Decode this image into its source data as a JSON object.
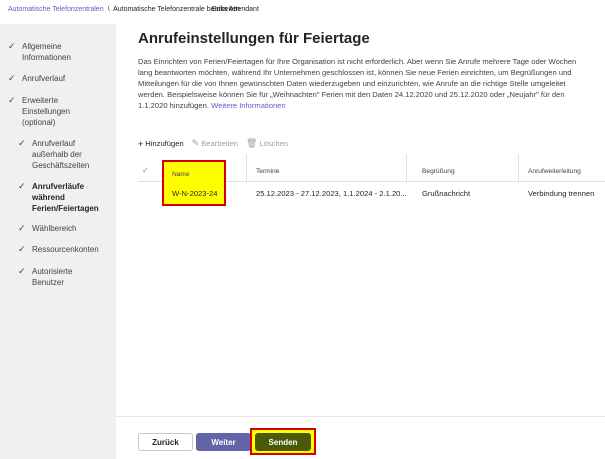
{
  "breadcrumb": {
    "link": "Automatische Telefonzentralen",
    "separator": "\\",
    "current": "Automatische Telefonzentrale bearbeiten",
    "overlap": "Eriks Attendant"
  },
  "sidebar": {
    "items": [
      {
        "label": "Allgemeine Informationen",
        "checked": true
      },
      {
        "label": "Anrufverlauf",
        "checked": true
      },
      {
        "label": "Erweiterte Einstellungen (optional)",
        "checked": true
      },
      {
        "label": "Anrufverlauf außerhalb der Geschäftszeiten",
        "checked": true
      },
      {
        "label": "Anrufverläufe während Ferien/Feiertagen",
        "checked": true,
        "active": true
      },
      {
        "label": "Wählbereich",
        "checked": true
      },
      {
        "label": "Ressourcenkonten",
        "checked": true
      },
      {
        "label": "Autorisierte Benutzer",
        "checked": true
      }
    ]
  },
  "main": {
    "title": "Anrufeinstellungen für Feiertage",
    "description": "Das Einrichten von Ferien/Feiertagen für Ihre Organisation ist nicht erforderlich. Aber wenn Sie Anrufe mehrere Tage oder Wochen lang beantworten möchten, während Ihr Unternehmen geschlossen ist, können Sie neue Ferien einrichten, um Begrüßungen und Mitteilungen für die von Ihnen gewünschten Daten wiederzugeben und einzurichten, wie Anrufe an die richtige Stelle umgeleitet werden. Beispielsweise können Sie für „Weihnachten\" Ferien mit den Daten 24.12.2020 und 25.12.2020 oder „Neujahr\" für den 1.1.2020 hinzufügen.",
    "more_link": "Weitere Informationen"
  },
  "toolbar": {
    "add": "Hinzufügen",
    "edit": "Bearbeiten",
    "delete": "Löschen"
  },
  "table": {
    "headers": [
      "Name",
      "Termine",
      "Begrüßung",
      "Anrufweiterleitung"
    ],
    "rows": [
      [
        "W-N-2023-24",
        "25.12.2023 - 27.12.2023, 1.1.2024 - 2.1.20...",
        "Grußnachricht",
        "Verbindung trennen"
      ]
    ]
  },
  "footer": {
    "back": "Zurück",
    "next": "Weiter",
    "send": "Senden"
  },
  "colors": {
    "accent": "#5b5fc7",
    "highlight": "#ffff00",
    "highlight_border": "#d40000",
    "send_button": "#4a5a06"
  }
}
